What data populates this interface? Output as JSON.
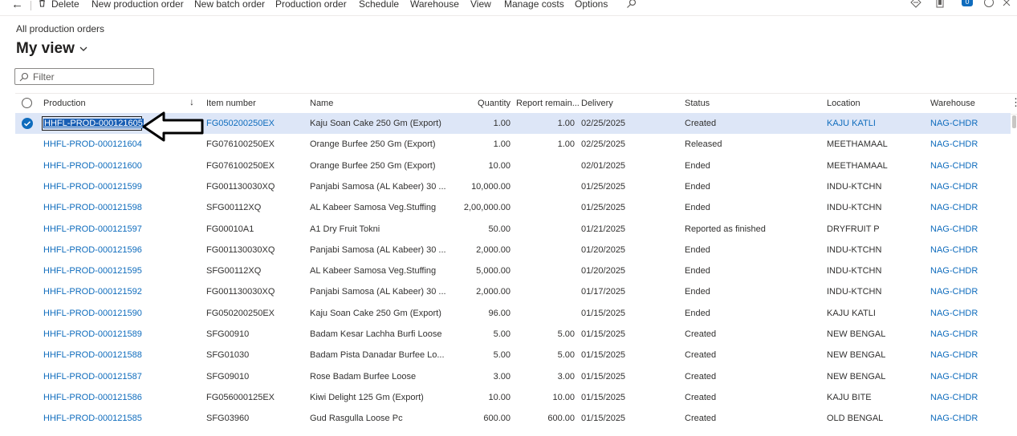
{
  "toolbar": {
    "delete": "Delete",
    "new_production_order": "New production order",
    "new_batch_order": "New batch order",
    "production_order": "Production order",
    "schedule": "Schedule",
    "warehouse": "Warehouse",
    "view": "View",
    "manage_costs": "Manage costs",
    "options": "Options",
    "notification_count": "0"
  },
  "breadcrumb": "All production orders",
  "view_title": "My view",
  "filter_placeholder": "Filter",
  "columns": {
    "production": "Production",
    "item_number": "Item number",
    "name": "Name",
    "quantity": "Quantity",
    "report_remaining": "Report remain...",
    "delivery": "Delivery",
    "status": "Status",
    "location": "Location",
    "warehouse": "Warehouse"
  },
  "rows": [
    {
      "production": "HHFL-PROD-000121605",
      "item": "FG050200250EX",
      "name": "Kaju Soan Cake 250 Gm (Export)",
      "qty": "1.00",
      "remain": "1.00",
      "delivery": "02/25/2025",
      "status": "Created",
      "location": "KAJU KATLI",
      "warehouse": "NAG-CHDR"
    },
    {
      "production": "HHFL-PROD-000121604",
      "item": "FG076100250EX",
      "name": "Orange Burfee 250 Gm (Export)",
      "qty": "1.00",
      "remain": "1.00",
      "delivery": "02/25/2025",
      "status": "Released",
      "location": "MEETHAMAAL",
      "warehouse": "NAG-CHDR"
    },
    {
      "production": "HHFL-PROD-000121600",
      "item": "FG076100250EX",
      "name": "Orange Burfee 250 Gm (Export)",
      "qty": "10.00",
      "remain": "",
      "delivery": "02/01/2025",
      "status": "Ended",
      "location": "MEETHAMAAL",
      "warehouse": "NAG-CHDR"
    },
    {
      "production": "HHFL-PROD-000121599",
      "item": "FG001130030XQ",
      "name": "Panjabi Samosa (AL Kabeer) 30 ...",
      "qty": "10,000.00",
      "remain": "",
      "delivery": "01/25/2025",
      "status": "Ended",
      "location": "INDU-KTCHN",
      "warehouse": "NAG-CHDR"
    },
    {
      "production": "HHFL-PROD-000121598",
      "item": "SFG00112XQ",
      "name": "AL Kabeer Samosa Veg.Stuffing",
      "qty": "2,00,000.00",
      "remain": "",
      "delivery": "01/25/2025",
      "status": "Ended",
      "location": "INDU-KTCHN",
      "warehouse": "NAG-CHDR"
    },
    {
      "production": "HHFL-PROD-000121597",
      "item": "FG00010A1",
      "name": "A1 Dry Fruit Tokni",
      "qty": "50.00",
      "remain": "",
      "delivery": "01/21/2025",
      "status": "Reported as finished",
      "location": "DRYFRUIT P",
      "warehouse": "NAG-CHDR"
    },
    {
      "production": "HHFL-PROD-000121596",
      "item": "FG001130030XQ",
      "name": "Panjabi Samosa (AL Kabeer) 30 ...",
      "qty": "2,000.00",
      "remain": "",
      "delivery": "01/20/2025",
      "status": "Ended",
      "location": "INDU-KTCHN",
      "warehouse": "NAG-CHDR"
    },
    {
      "production": "HHFL-PROD-000121595",
      "item": "SFG00112XQ",
      "name": "AL Kabeer Samosa Veg.Stuffing",
      "qty": "5,000.00",
      "remain": "",
      "delivery": "01/20/2025",
      "status": "Ended",
      "location": "INDU-KTCHN",
      "warehouse": "NAG-CHDR"
    },
    {
      "production": "HHFL-PROD-000121592",
      "item": "FG001130030XQ",
      "name": "Panjabi Samosa (AL Kabeer) 30 ...",
      "qty": "2,000.00",
      "remain": "",
      "delivery": "01/17/2025",
      "status": "Ended",
      "location": "INDU-KTCHN",
      "warehouse": "NAG-CHDR"
    },
    {
      "production": "HHFL-PROD-000121590",
      "item": "FG050200250EX",
      "name": "Kaju Soan Cake 250 Gm (Export)",
      "qty": "96.00",
      "remain": "",
      "delivery": "01/15/2025",
      "status": "Ended",
      "location": "KAJU KATLI",
      "warehouse": "NAG-CHDR"
    },
    {
      "production": "HHFL-PROD-000121589",
      "item": "SFG00910",
      "name": "Badam Kesar Lachha Burfi Loose",
      "qty": "5.00",
      "remain": "5.00",
      "delivery": "01/15/2025",
      "status": "Created",
      "location": "NEW BENGAL",
      "warehouse": "NAG-CHDR"
    },
    {
      "production": "HHFL-PROD-000121588",
      "item": "SFG01030",
      "name": "Badam Pista Danadar Burfee Lo...",
      "qty": "5.00",
      "remain": "5.00",
      "delivery": "01/15/2025",
      "status": "Created",
      "location": "NEW BENGAL",
      "warehouse": "NAG-CHDR"
    },
    {
      "production": "HHFL-PROD-000121587",
      "item": "SFG09010",
      "name": "Rose Badam Burfee Loose",
      "qty": "3.00",
      "remain": "3.00",
      "delivery": "01/15/2025",
      "status": "Created",
      "location": "NEW BENGAL",
      "warehouse": "NAG-CHDR"
    },
    {
      "production": "HHFL-PROD-000121586",
      "item": "FG056000125EX",
      "name": "Kiwi Delight 125 Gm (Export)",
      "qty": "10.00",
      "remain": "10.00",
      "delivery": "01/15/2025",
      "status": "Created",
      "location": "KAJU BITE",
      "warehouse": "NAG-CHDR"
    },
    {
      "production": "HHFL-PROD-000121585",
      "item": "SFG03960",
      "name": "Gud Rasgulla Loose Pc",
      "qty": "600.00",
      "remain": "600.00",
      "delivery": "01/15/2025",
      "status": "Created",
      "location": "OLD BENGAL",
      "warehouse": "NAG-CHDR"
    }
  ],
  "colors": {
    "link": "#0f6cbd",
    "selected_row": "#dde6f7",
    "accent": "#0f6cbd"
  }
}
